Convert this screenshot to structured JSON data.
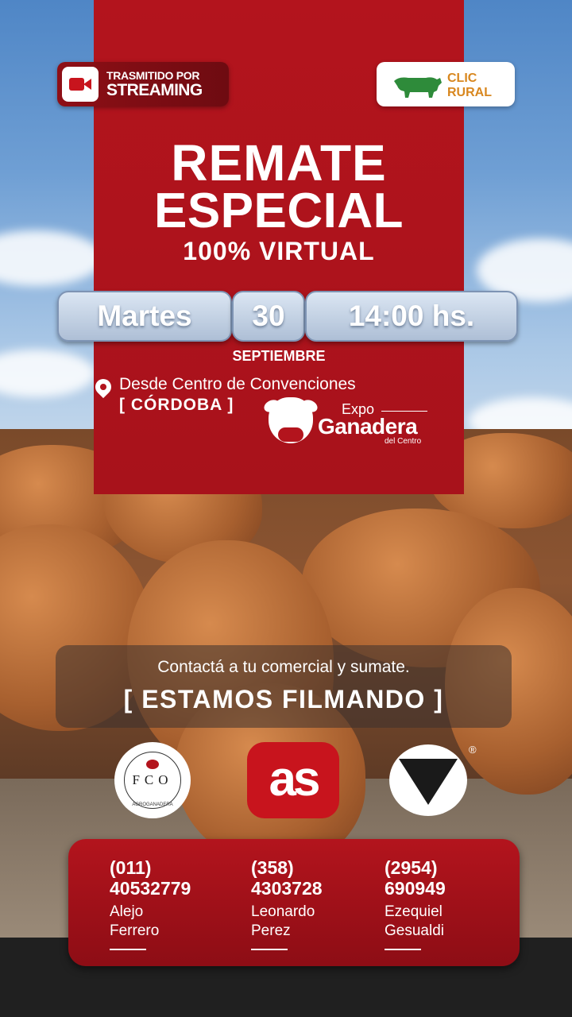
{
  "streaming_badge": {
    "line1": "TRASMITIDO POR",
    "line2": "STREAMING",
    "icon": "video-camera-icon"
  },
  "brand_badge": {
    "line1": "CLIC",
    "line2": "RURAL",
    "icon": "cow-icon",
    "color": "#d8871f",
    "icon_color": "#2e8b3a"
  },
  "headline": {
    "line1": "REMATE",
    "line2": "ESPECIAL",
    "line3": "100% VIRTUAL"
  },
  "date": {
    "day_name": "Martes",
    "day_number": "30",
    "time": "14:00 hs.",
    "month": "SEPTIEMBRE"
  },
  "location": {
    "venue": "Desde Centro de Convenciones",
    "city": "[ CÓRDOBA ]",
    "icon": "location-pin-icon"
  },
  "expo_logo": {
    "line1": "Expo",
    "line2": "Ganadera",
    "line3": "del Centro"
  },
  "cta": {
    "text": "Contactá a tu comercial y sumate.",
    "banner": "[ ESTAMOS FILMANDO ]"
  },
  "partner_logos": {
    "fco": {
      "letters": "FCO",
      "subtitle": "AGROGANADERA"
    },
    "as": {
      "text": "as"
    },
    "v": {
      "registered": "®"
    }
  },
  "contacts": [
    {
      "area_code": "(011)",
      "number": "40532779",
      "first_name": "Alejo",
      "last_name": "Ferrero"
    },
    {
      "area_code": "(358)",
      "number": "4303728",
      "first_name": "Leonardo",
      "last_name": "Perez"
    },
    {
      "area_code": "(2954)",
      "number": "690949",
      "first_name": "Ezequiel",
      "last_name": "Gesualdi"
    }
  ],
  "colors": {
    "brand_red": "#b3141d",
    "pill_blue": "#aebfd6",
    "text_white": "#ffffff"
  }
}
